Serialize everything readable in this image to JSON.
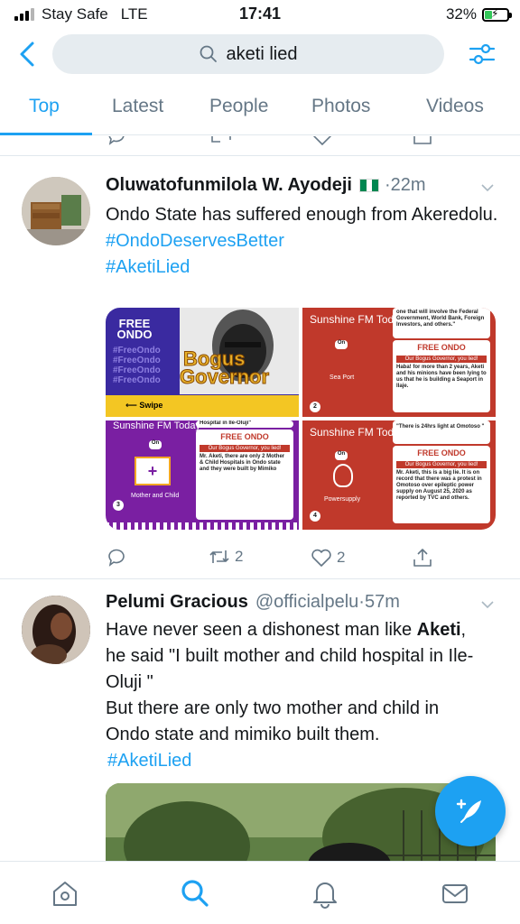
{
  "status_bar": {
    "carrier": "Stay Safe",
    "network": "LTE",
    "time": "17:41",
    "battery": "32%"
  },
  "search": {
    "query": "aketi lied"
  },
  "tabs": [
    {
      "label": "Top",
      "active": true
    },
    {
      "label": "Latest"
    },
    {
      "label": "People"
    },
    {
      "label": "Photos"
    },
    {
      "label": "Videos"
    }
  ],
  "tweets": [
    {
      "name": "Oluwatofunmilola W. Ayodeji",
      "time": "22m",
      "text": "Ondo State has suffered enough from Akeredolu.",
      "hashtags": [
        "#OndoDeservesBetter",
        "#AketiLied"
      ],
      "retweets": "2",
      "likes": "2",
      "media": {
        "c1": {
          "tag": "FREE ONDO",
          "repeat": "#FreeOndo",
          "title1": "Bogus",
          "title2": "Governor",
          "swipe": "Swipe"
        },
        "c2": {
          "station": "Sunshine FM Today",
          "quote": "one that will involve the Federal Government, World Bank, Foreign Investors, and others.\"",
          "on": "On",
          "label": "Sea Port",
          "free": "FREE ONDO",
          "banner": "Our Bogus Governor, you lied!",
          "body": "Haba! for more than 2 years, Aketi and his minions have been lying to us that he is building a Seaport in Ilaje.",
          "num": "2"
        },
        "c3": {
          "station": "Sunshine FM Today",
          "quote": "Hospital in Ile-Oluji\"",
          "on": "On",
          "label": "Mother and Child",
          "free": "FREE ONDO",
          "banner": "Our Bogus Governor, you lied!",
          "body": "Mr. Aketi, there are only 2 Mother & Child Hospitals in Ondo state and they were built by Mimiko",
          "num": "3"
        },
        "c4": {
          "station": "Sunshine FM Today",
          "quote": "\"There is 24hrs light at Omotoso \"",
          "on": "On",
          "label": "Powersupply",
          "free": "FREE ONDO",
          "banner": "Our Bogus Governor, you lied!",
          "body": "Mr. Aketi, this is a big lie. It is on record that there was a protest in Omotoso over epileptic power supply on August 25, 2020 as reported by TVC and others.",
          "num": "4"
        }
      }
    },
    {
      "name": "Pelumi Gracious",
      "handle": "@officialpelu",
      "time": "57m",
      "text_part1": "Have never seen a dishonest man like ",
      "text_bold": "Aketi",
      "text_part2": ", he said \"I built mother and child hospital in Ile-Oluji \"",
      "text_line2": "But there are only two mother and child in Ondo state and mimiko built them.",
      "hashtag": "#AketiLied"
    }
  ],
  "colors": {
    "accent": "#1da1f2",
    "secondary_text": "#657786",
    "divider": "#e1e8ed"
  }
}
